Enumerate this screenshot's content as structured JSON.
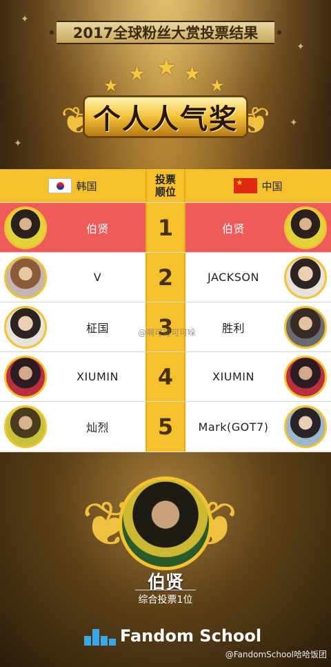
{
  "header": {
    "title": "2017全球粉丝大赏投票结果",
    "award": "个人人气奖"
  },
  "table": {
    "left_label": "韩国",
    "mid_label_1": "投票",
    "mid_label_2": "顺位",
    "right_label": "中国",
    "rows": [
      {
        "rank": "1",
        "korea": "伯贤",
        "china": "伯贤"
      },
      {
        "rank": "2",
        "korea": "V",
        "china": "JACKSON"
      },
      {
        "rank": "3",
        "korea": "柾国",
        "china": "胜利"
      },
      {
        "rank": "4",
        "korea": "XIUMIN",
        "china": "XIUMIN"
      },
      {
        "rank": "5",
        "korea": "灿烈",
        "china": "Mark(GOT7)"
      }
    ],
    "watermark": "@啊可可可可哚"
  },
  "winner": {
    "name": "伯贤",
    "subtitle": "综合投票1位"
  },
  "brand": {
    "name": "Fandom School",
    "credit": "@FandomSchool哈哈饭团"
  },
  "colors": {
    "gold": "#f7c12c",
    "highlight_row": "#ef5a5a",
    "brand_blue": "#3aa8e8"
  }
}
